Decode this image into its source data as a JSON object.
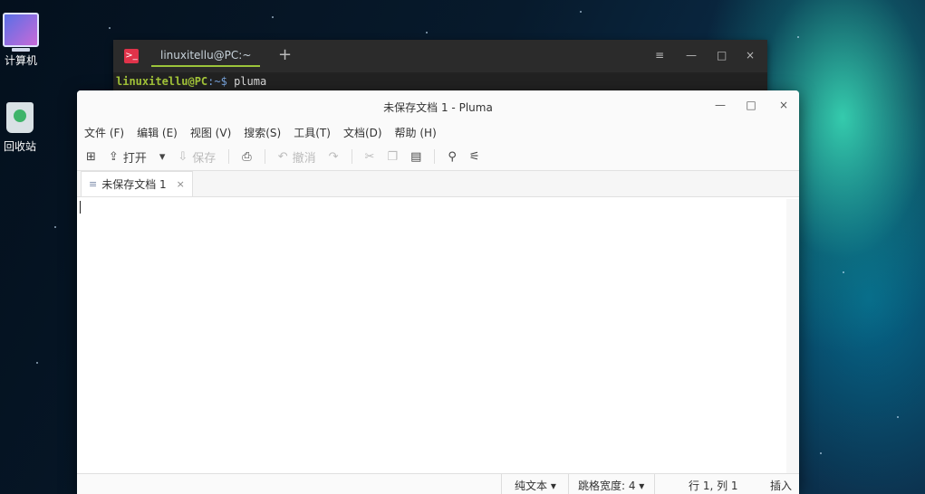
{
  "desktop": {
    "icons": [
      {
        "label": "计算机"
      },
      {
        "label": "回收站"
      }
    ]
  },
  "terminal": {
    "tab_title": "linuxitellu@PC:~",
    "tab_icon": ">_",
    "new_tab": "+",
    "controls": {
      "menu": "≡",
      "minimize": "—",
      "maximize": "□",
      "close": "×"
    },
    "prompt_user": "linuxitellu@PC",
    "prompt_path": ":~$",
    "command": " pluma"
  },
  "pluma": {
    "title": "未保存文档 1 - Pluma",
    "controls": {
      "minimize": "—",
      "maximize": "□",
      "close": "×"
    },
    "menu": [
      "文件 (F)",
      "编辑 (E)",
      "视图 (V)",
      "搜索(S)",
      "工具(T)",
      "文档(D)",
      "帮助 (H)"
    ],
    "toolbar": {
      "new_icon": "⊞",
      "open_icon": "⇪",
      "open_label": "打开",
      "open_dropdown": "▾",
      "save_icon": "⇩",
      "save_label": "保存",
      "print_icon": "⎙",
      "undo_icon": "↶",
      "undo_label": "撤消",
      "redo_icon": "↷",
      "cut_icon": "✂",
      "copy_icon": "❐",
      "paste_icon": "▤",
      "find_icon": "⚲",
      "replace_icon": "⚟"
    },
    "tab": {
      "icon": "≡",
      "label": "未保存文档 1",
      "close": "×"
    },
    "status": {
      "syntax": "纯文本 ▾",
      "tab_width": "跳格宽度: 4 ▾",
      "position": "行 1, 列 1",
      "mode": "插入"
    }
  }
}
